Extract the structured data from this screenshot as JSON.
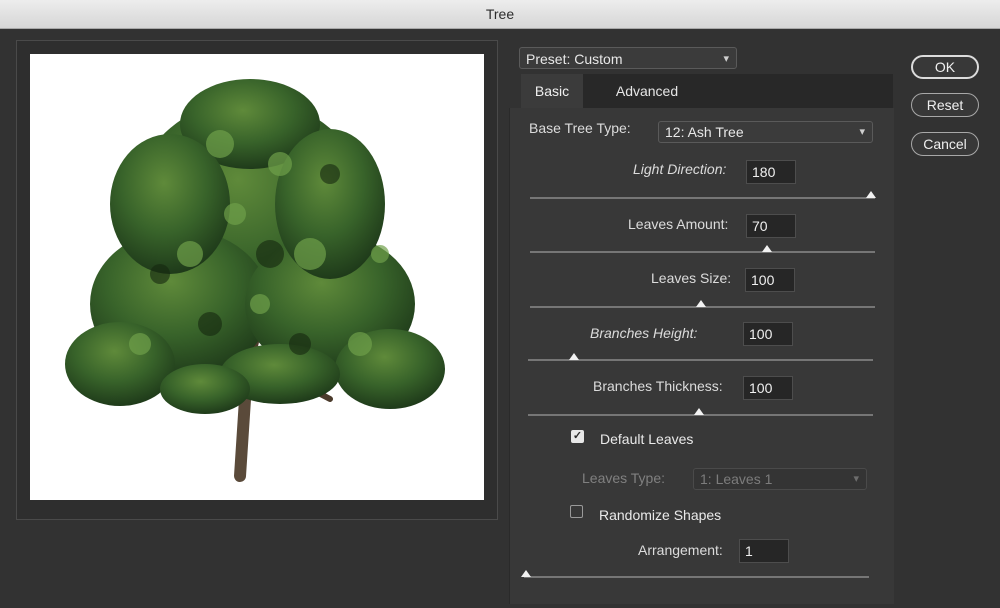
{
  "window": {
    "title": "Tree"
  },
  "preset": {
    "label": "Preset: Custom"
  },
  "tabs": [
    {
      "label": "Basic"
    },
    {
      "label": "Advanced"
    }
  ],
  "basic": {
    "base_tree_type": {
      "label": "Base Tree Type:",
      "value": "12: Ash Tree"
    },
    "light_direction": {
      "label": "Light Direction:",
      "value": "180",
      "slider_fraction": 0.99
    },
    "leaves_amount": {
      "label": "Leaves Amount:",
      "value": "70",
      "slider_fraction": 0.7
    },
    "leaves_size": {
      "label": "Leaves Size:",
      "value": "100",
      "slider_fraction": 0.5
    },
    "branches_height": {
      "label": "Branches Height:",
      "value": "100",
      "slider_fraction": 0.13
    },
    "branches_thickness": {
      "label": "Branches Thickness:",
      "value": "100",
      "slider_fraction": 0.5
    },
    "default_leaves": {
      "label": "Default Leaves",
      "checked": true
    },
    "leaves_type": {
      "label": "Leaves Type:",
      "value": "1: Leaves 1",
      "disabled": true
    },
    "randomize_shapes": {
      "label": "Randomize Shapes",
      "checked": false
    },
    "arrangement": {
      "label": "Arrangement:",
      "value": "1",
      "slider_fraction": 0.0
    }
  },
  "buttons": {
    "ok": "OK",
    "reset": "Reset",
    "cancel": "Cancel"
  },
  "icons": {
    "dropdown": "chevron-down-icon",
    "checkmark": "checkmark-icon"
  },
  "colors": {
    "dialog_bg": "#323232",
    "panel_bg": "#383838",
    "preview_bg": "#ffffff",
    "foliage": "#3d6b2a"
  }
}
